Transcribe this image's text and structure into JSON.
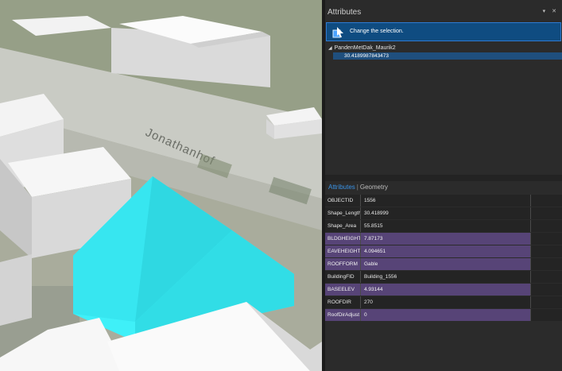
{
  "scene": {
    "street_label": "Jonathanhof"
  },
  "pane": {
    "title": "Attributes",
    "controls": "▾ ✕",
    "selection_message": "Change the selection.",
    "tree": {
      "layer_name": "PandenMetDak_Maurik2",
      "selected_feature": "30.4189987843473"
    },
    "tabs": {
      "attributes": "Attributes",
      "separator": "|",
      "geometry": "Geometry"
    },
    "fields": [
      {
        "name": "OBJECTID",
        "value": "1556",
        "highlighted": false
      },
      {
        "name": "Shape_Length",
        "value": "30.418999",
        "highlighted": false
      },
      {
        "name": "Shape_Area",
        "value": "55.8515",
        "highlighted": false
      },
      {
        "name": "BLDGHEIGHT",
        "value": "7.87173",
        "highlighted": true
      },
      {
        "name": "EAVEHEIGHT",
        "value": "4.094651",
        "highlighted": true
      },
      {
        "name": "ROOFFORM",
        "value": "Gable",
        "highlighted": true
      },
      {
        "name": "BuildingFID",
        "value": "Building_1556",
        "highlighted": false
      },
      {
        "name": "BASEELEV",
        "value": "4.93144",
        "highlighted": true
      },
      {
        "name": "ROOFDIR",
        "value": "270",
        "highlighted": false
      },
      {
        "name": "RoofDirAdjust",
        "value": "0",
        "highlighted": true
      }
    ]
  },
  "colors": {
    "selection_blue": "#0f4c81",
    "highlight_purple": "#574477",
    "selected_building": "#38e9f2",
    "tab_active": "#3a93e6"
  }
}
